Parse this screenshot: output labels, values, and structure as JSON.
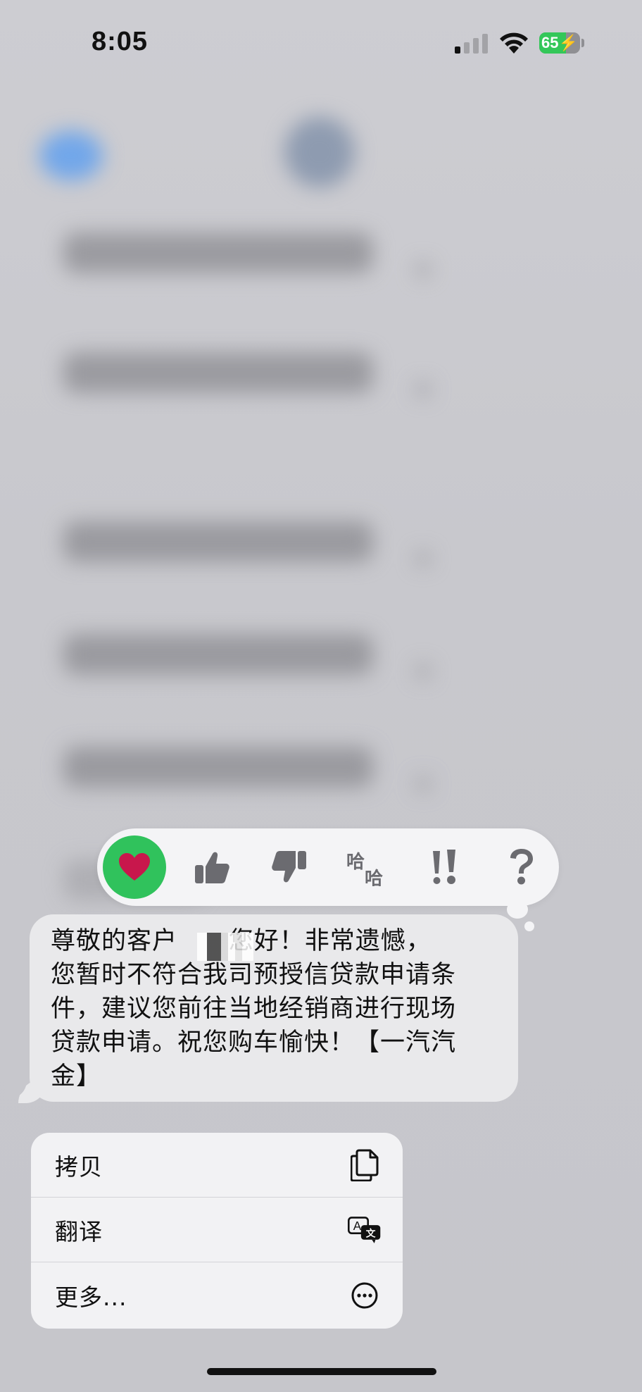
{
  "status_bar": {
    "time": "8:05",
    "battery_percent": "65",
    "battery_level": 0.65,
    "battery_charging": true,
    "signal_bars_active": 1
  },
  "reactions": [
    {
      "name": "heart",
      "selected": true
    },
    {
      "name": "thumbs-up",
      "selected": false
    },
    {
      "name": "thumbs-down",
      "selected": false
    },
    {
      "name": "haha",
      "selected": false
    },
    {
      "name": "exclamation",
      "selected": false
    },
    {
      "name": "question",
      "selected": false
    }
  ],
  "message": {
    "text": "尊敬的客户      您好！非常遗憾，\n您暂时不符合我司预授信贷款申请条\n件，建议您前往当地经销商进行现场\n贷款申请。祝您购车愉快！【一汽汽\n金】"
  },
  "context_menu": {
    "items": [
      {
        "label": "拷贝",
        "icon": "copy-icon"
      },
      {
        "label": "翻译",
        "icon": "translate-icon"
      },
      {
        "label": "更多...",
        "icon": "more-icon"
      }
    ]
  },
  "colors": {
    "reaction_selected": "#30c25c",
    "heart": "#c8174c",
    "battery_green": "#34c759",
    "bubble": "#e9e9eb"
  }
}
